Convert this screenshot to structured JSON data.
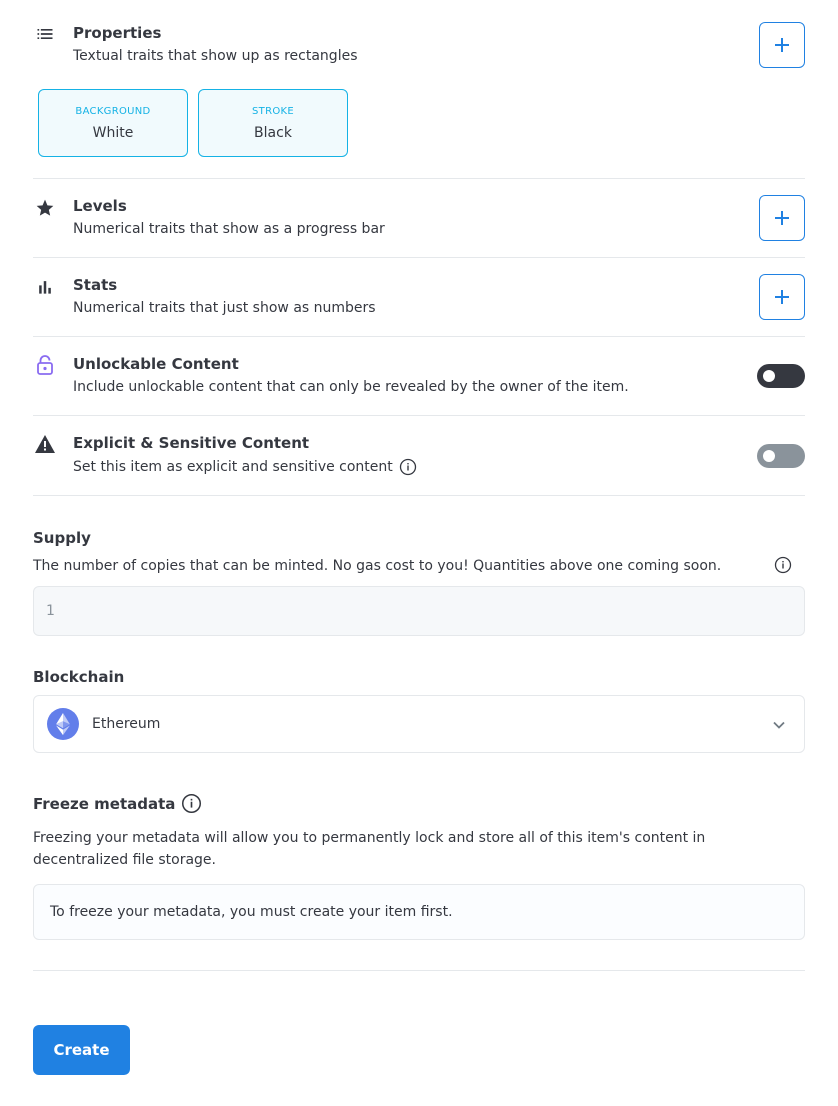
{
  "properties": {
    "title": "Properties",
    "description": "Textual traits that show up as rectangles",
    "items": [
      {
        "type": "BACKGROUND",
        "value": "White"
      },
      {
        "type": "STROKE",
        "value": "Black"
      }
    ]
  },
  "levels": {
    "title": "Levels",
    "description": "Numerical traits that show as a progress bar"
  },
  "stats": {
    "title": "Stats",
    "description": "Numerical traits that just show as numbers"
  },
  "unlockable": {
    "title": "Unlockable Content",
    "description": "Include unlockable content that can only be revealed by the owner of the item.",
    "enabled": false
  },
  "explicit": {
    "title": "Explicit & Sensitive Content",
    "description": "Set this item as explicit and sensitive content",
    "enabled": false
  },
  "supply": {
    "title": "Supply",
    "description": "The number of copies that can be minted. No gas cost to you! Quantities above one coming soon.",
    "value": "1"
  },
  "blockchain": {
    "title": "Blockchain",
    "selected": "Ethereum"
  },
  "freeze": {
    "title": "Freeze metadata",
    "description": "Freezing your metadata will allow you to permanently lock and store all of this item's content in decentralized file storage.",
    "notice": "To freeze your metadata, you must create your item first."
  },
  "create_label": "Create",
  "colors": {
    "accent": "#2081e2",
    "property_border": "#15b2e5",
    "toggle_dark": "#353840",
    "toggle_grey": "#8a939b",
    "lock_purple": "#8a6cf1",
    "eth_blue": "#627eea"
  }
}
